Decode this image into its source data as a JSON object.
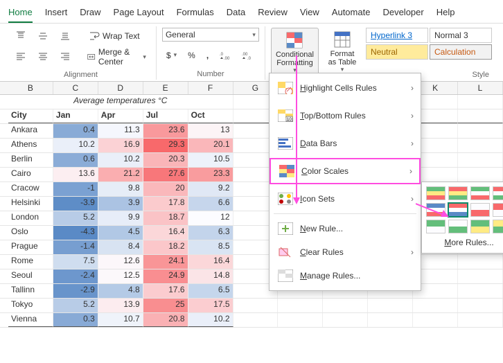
{
  "tabs": [
    "Home",
    "Insert",
    "Draw",
    "Page Layout",
    "Formulas",
    "Data",
    "Review",
    "View",
    "Automate",
    "Developer",
    "Help"
  ],
  "active_tab": 0,
  "ribbon": {
    "alignment": {
      "wrap": "Wrap Text",
      "merge": "Merge & Center",
      "label": "Alignment"
    },
    "number": {
      "format": "General",
      "label": "Number"
    },
    "cf": {
      "btn": "Conditional Formatting",
      "fmt_table": "Format as Table",
      "styles_label": "Style"
    },
    "styles": [
      "Hyperlink 3",
      "Normal 3",
      "Neutral",
      "Calculation"
    ]
  },
  "cf_menu": {
    "items": [
      {
        "label": "Highlight Cells Rules",
        "sub": true,
        "u": 0
      },
      {
        "label": "Top/Bottom Rules",
        "sub": true,
        "u": 0
      },
      {
        "label": "Data Bars",
        "sub": true,
        "u": 0
      },
      {
        "label": "Color Scales",
        "sub": true,
        "u": 0,
        "hl": true
      },
      {
        "label": "Icon Sets",
        "sub": true,
        "u": 0
      }
    ],
    "new_rule": "New Rule...",
    "clear": "Clear Rules",
    "manage": "Manage Rules...",
    "more_rules": "More Rules..."
  },
  "scales": [
    [
      "#63be7b",
      "#ffeb84",
      "#f8696b"
    ],
    [
      "#f8696b",
      "#ffeb84",
      "#63be7b"
    ],
    [
      "#63be7b",
      "#fcfcff",
      "#f8696b"
    ],
    [
      "#f8696b",
      "#fcfcff",
      "#63be7b"
    ],
    [
      "#5a8ac6",
      "#fcfcff",
      "#f8696b"
    ],
    [
      "#f8696b",
      "#fcfcff",
      "#5a8ac6"
    ],
    [
      "#fcfcff",
      "#f8696b"
    ],
    [
      "#f8696b",
      "#fcfcff"
    ],
    [
      "#63be7b",
      "#fcfcff"
    ],
    [
      "#fcfcff",
      "#63be7b"
    ],
    [
      "#63be7b",
      "#ffeb84"
    ],
    [
      "#ffeb84",
      "#63be7b"
    ]
  ],
  "scale_sel": 5,
  "grid": {
    "cols": [
      "B",
      "C",
      "D",
      "E",
      "F",
      "G",
      "H",
      "I",
      "J",
      "K",
      "L"
    ],
    "title": "Average temperatures °C",
    "headers": [
      "City",
      "Jan",
      "Apr",
      "Jul",
      "Oct"
    ],
    "rows": [
      {
        "city": "Ankara",
        "v": [
          0.4,
          11.3,
          23.6,
          13
        ]
      },
      {
        "city": "Athens",
        "v": [
          10.2,
          16.9,
          29.3,
          20.1
        ]
      },
      {
        "city": "Berlin",
        "v": [
          0.6,
          10.2,
          20.3,
          10.5
        ]
      },
      {
        "city": "Cairo",
        "v": [
          13.6,
          21.2,
          27.6,
          23.3
        ]
      },
      {
        "city": "Cracow",
        "v": [
          -1,
          9.8,
          20,
          9.2
        ]
      },
      {
        "city": "Helsinki",
        "v": [
          -3.9,
          3.9,
          17.8,
          6.6
        ]
      },
      {
        "city": "London",
        "v": [
          5.2,
          9.9,
          18.7,
          12
        ]
      },
      {
        "city": "Oslo",
        "v": [
          -4.3,
          4.5,
          16.4,
          6.3
        ]
      },
      {
        "city": "Prague",
        "v": [
          -1.4,
          8.4,
          18.2,
          8.5
        ]
      },
      {
        "city": "Rome",
        "v": [
          7.5,
          12.6,
          24.1,
          16.4
        ]
      },
      {
        "city": "Seoul",
        "v": [
          -2.4,
          12.5,
          24.9,
          14.8
        ]
      },
      {
        "city": "Tallinn",
        "v": [
          -2.9,
          4.8,
          17.6,
          6.5
        ]
      },
      {
        "city": "Tokyo",
        "v": [
          5.2,
          13.9,
          25,
          17.5
        ]
      },
      {
        "city": "Vienna",
        "v": [
          0.3,
          10.7,
          20.8,
          10.2
        ]
      }
    ]
  },
  "chart_data": {
    "type": "table",
    "title": "Average temperatures °C",
    "columns": [
      "City",
      "Jan",
      "Apr",
      "Jul",
      "Oct"
    ],
    "rows": [
      [
        "Ankara",
        0.4,
        11.3,
        23.6,
        13
      ],
      [
        "Athens",
        10.2,
        16.9,
        29.3,
        20.1
      ],
      [
        "Berlin",
        0.6,
        10.2,
        20.3,
        10.5
      ],
      [
        "Cairo",
        13.6,
        21.2,
        27.6,
        23.3
      ],
      [
        "Cracow",
        -1,
        9.8,
        20,
        9.2
      ],
      [
        "Helsinki",
        -3.9,
        3.9,
        17.8,
        6.6
      ],
      [
        "London",
        5.2,
        9.9,
        18.7,
        12
      ],
      [
        "Oslo",
        -4.3,
        4.5,
        16.4,
        6.3
      ],
      [
        "Prague",
        -1.4,
        8.4,
        18.2,
        8.5
      ],
      [
        "Rome",
        7.5,
        12.6,
        24.1,
        16.4
      ],
      [
        "Seoul",
        -2.4,
        12.5,
        24.9,
        14.8
      ],
      [
        "Tallinn",
        -2.9,
        4.8,
        17.6,
        6.5
      ],
      [
        "Tokyo",
        5.2,
        13.9,
        25,
        17.5
      ],
      [
        "Vienna",
        0.3,
        10.7,
        20.8,
        10.2
      ]
    ],
    "color_scale": {
      "min": "#5a8ac6",
      "mid": "#fcfcff",
      "max": "#f8696b",
      "vmin": -4.3,
      "vmid": 12,
      "vmax": 29.3
    }
  }
}
